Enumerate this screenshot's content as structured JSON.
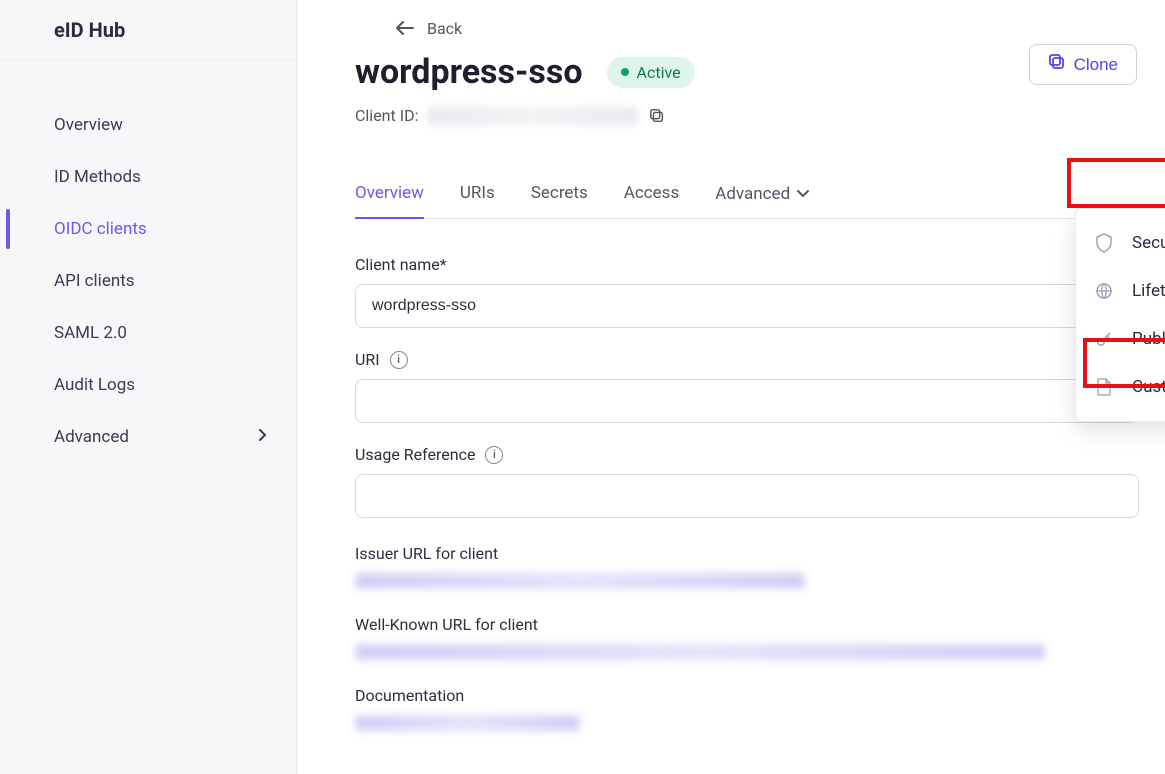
{
  "brand": "eID Hub",
  "sidebar": {
    "items": [
      {
        "label": "Overview"
      },
      {
        "label": "ID Methods"
      },
      {
        "label": "OIDC clients"
      },
      {
        "label": "API clients"
      },
      {
        "label": "SAML 2.0"
      },
      {
        "label": "Audit Logs"
      },
      {
        "label": "Advanced"
      }
    ]
  },
  "header": {
    "back": "Back",
    "title": "wordpress-sso",
    "status": "Active",
    "clone": "Clone",
    "client_id_label": "Client ID:"
  },
  "tabs": [
    {
      "label": "Overview"
    },
    {
      "label": "URIs"
    },
    {
      "label": "Secrets"
    },
    {
      "label": "Access"
    },
    {
      "label": "Advanced"
    }
  ],
  "dropdown": [
    {
      "label": "Security"
    },
    {
      "label": "Lifetimes"
    },
    {
      "label": "Public keys"
    },
    {
      "label": "Custom claims"
    }
  ],
  "form": {
    "client_name_label": "Client name*",
    "client_name_value": "wordpress-sso",
    "uri_label": "URI",
    "uri_value": "",
    "usage_ref_label": "Usage Reference",
    "usage_ref_value": "",
    "issuer_label": "Issuer URL for client",
    "wellknown_label": "Well-Known URL for client",
    "documentation_label": "Documentation"
  }
}
